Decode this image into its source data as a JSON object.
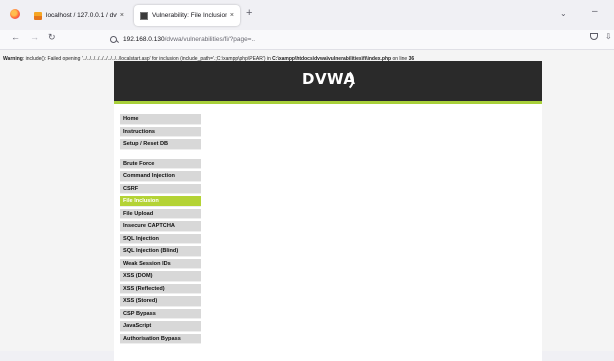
{
  "browser": {
    "tabs": [
      {
        "title": "localhost / 127.0.0.1 / dvwa / t",
        "active": false
      },
      {
        "title": "Vulnerability: File Inclusion :: D",
        "active": true
      }
    ],
    "tab_close_glyph": "×",
    "new_tab_glyph": "+",
    "url_host": "192.168.0.130",
    "url_path": "/dvwa/vulnerabilities/fi/?page=.."
  },
  "page": {
    "warning_label": "Warning",
    "warning_text": ": include(): Failed opening '../../../../../../../../../localstart.asp' for inclusion (include_path='.;C:\\xampp\\php\\PEAR') in ",
    "warning_file": "C:\\xampp\\htdocs\\dvwa\\vulnerabilities\\fi\\index.php",
    "warning_line_text": " on line ",
    "warning_line": "36",
    "logo_text": "DVWA",
    "menu_group1": [
      "Home",
      "Instructions",
      "Setup / Reset DB"
    ],
    "menu_group2": [
      "Brute Force",
      "Command Injection",
      "CSRF",
      "File Inclusion",
      "File Upload",
      "Insecure CAPTCHA",
      "SQL Injection",
      "SQL Injection (Blind)",
      "Weak Session IDs",
      "XSS (DOM)",
      "XSS (Reflected)",
      "XSS (Stored)",
      "CSP Bypass",
      "JavaScript",
      "Authorisation Bypass"
    ],
    "active_item": "File Inclusion"
  },
  "colors": {
    "accent_green": "#b4d335",
    "header_bg": "#2a2a2a",
    "menu_bg": "#d8d8d8"
  },
  "icons": [
    "firefox-icon",
    "back-arrow-icon",
    "forward-arrow-icon",
    "reload-icon",
    "search-icon",
    "pocket-icon",
    "extensions-icon",
    "tab-list-chevron-icon",
    "minimize-icon"
  ]
}
